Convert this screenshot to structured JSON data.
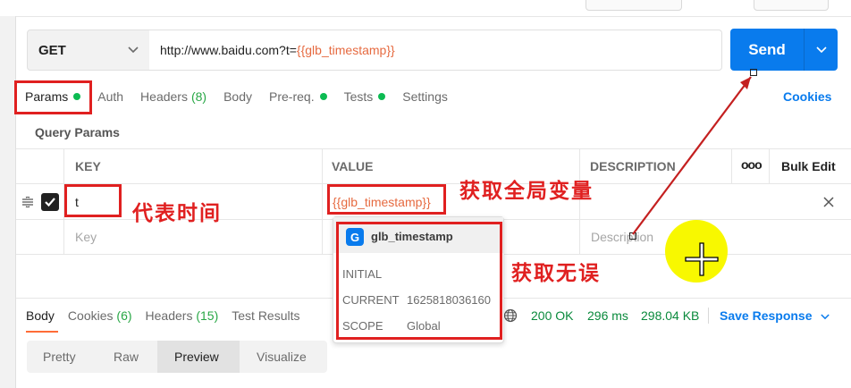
{
  "request": {
    "method": "GET",
    "url_prefix": "http://www.baidu.com?t=",
    "url_variable": "{{glb_timestamp}}",
    "send_label": "Send"
  },
  "tabs": [
    {
      "label": "Params",
      "dot": true
    },
    {
      "label": "Auth"
    },
    {
      "label": "Headers",
      "count": "(8)"
    },
    {
      "label": "Body"
    },
    {
      "label": "Pre-req.",
      "dot": true
    },
    {
      "label": "Tests",
      "dot": true
    },
    {
      "label": "Settings"
    }
  ],
  "cookies_label": "Cookies",
  "query_params_title": "Query Params",
  "table": {
    "headers": {
      "key": "KEY",
      "value": "VALUE",
      "description": "DESCRIPTION",
      "more": "ooo",
      "bulk_edit": "Bulk Edit"
    },
    "rows": [
      {
        "key": "t",
        "value": "{{glb_timestamp}}"
      }
    ],
    "placeholders": {
      "key": "Key",
      "description": "Description"
    }
  },
  "popup": {
    "badge": "G",
    "name": "glb_timestamp",
    "initial_label": "INITIAL",
    "current_label": "CURRENT",
    "current_value": "1625818036160",
    "scope_label": "SCOPE",
    "scope_value": "Global"
  },
  "response": {
    "tabs": [
      {
        "label": "Body"
      },
      {
        "label": "Cookies",
        "count": "(6)"
      },
      {
        "label": "Headers",
        "count": "(15)"
      },
      {
        "label": "Test Results"
      }
    ],
    "status": "200 OK",
    "time": "296 ms",
    "size": "298.04 KB",
    "save_label": "Save Response",
    "view_modes": [
      "Pretty",
      "Raw",
      "Preview",
      "Visualize"
    ],
    "active_view": "Preview"
  },
  "annotations": {
    "represents_time": "代表时间",
    "get_global_variable": "获取全局变量",
    "get_correct": "获取无误"
  },
  "colors": {
    "accent": "#097bed",
    "variable": "#e66a40",
    "status_green": "#0cbb52",
    "annotation_red": "#e02020",
    "tab_underline": "#ff6c37"
  },
  "icons": [
    "chevron-down-icon",
    "drag-handle-icon",
    "checkbox-checked-icon",
    "close-icon",
    "globe-icon",
    "more-icon",
    "crosshair-cursor-icon"
  ]
}
